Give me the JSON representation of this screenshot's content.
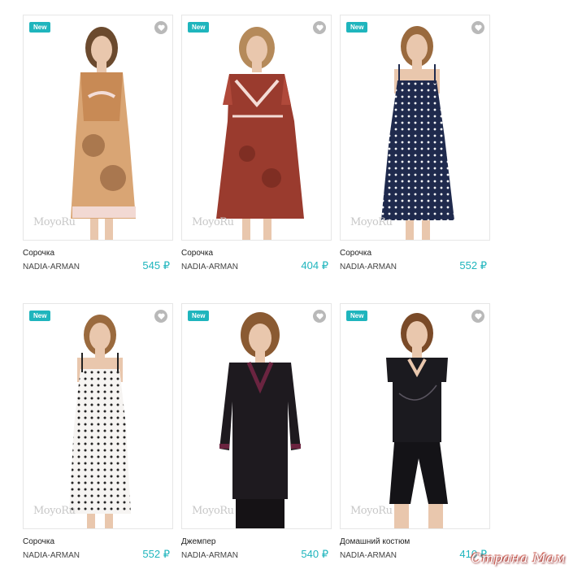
{
  "products": [
    {
      "badge": "New",
      "name": "Сорочка",
      "brand": "NADIA-ARMAN",
      "price": "545 ₽",
      "watermark": "MoyoRu"
    },
    {
      "badge": "New",
      "name": "Сорочка",
      "brand": "NADIA-ARMAN",
      "price": "404 ₽",
      "watermark": "MoyoRu"
    },
    {
      "badge": "New",
      "name": "Сорочка",
      "brand": "NADIA-ARMAN",
      "price": "552 ₽",
      "watermark": "MoyoRu"
    },
    {
      "badge": "New",
      "name": "Сорочка",
      "brand": "NADIA-ARMAN",
      "price": "552 ₽",
      "watermark": "MoyoRu"
    },
    {
      "badge": "New",
      "name": "Джемпер",
      "brand": "NADIA-ARMAN",
      "price": "540 ₽",
      "watermark": "MoyoRu"
    },
    {
      "badge": "New",
      "name": "Домашний костюм",
      "brand": "NADIA-ARMAN",
      "price": "410 ₽",
      "watermark": "MoyoRu"
    }
  ],
  "site_watermark": "Страна Мам",
  "colors": {
    "accent": "#1fb5bd",
    "favorite": "#b9b9b9"
  },
  "icons": {
    "favorite": "heart-icon"
  }
}
